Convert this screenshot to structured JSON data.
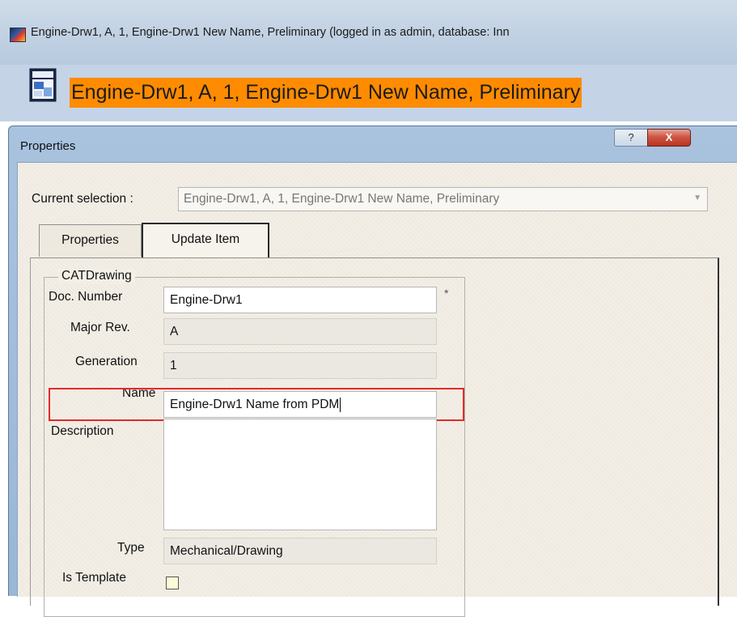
{
  "app": {
    "window_title": "Engine-Drw1, A, 1, Engine-Drw1 New Name, Preliminary (logged in as admin, database: Inn",
    "document_title": "Engine-Drw1, A, 1, Engine-Drw1 New Name, Preliminary"
  },
  "dialog": {
    "title": "Properties",
    "help_label": "?",
    "close_label": "X",
    "current_selection": {
      "label": "Current selection :",
      "value": "Engine-Drw1, A, 1, Engine-Drw1 New Name, Preliminary",
      "arrow": "▼"
    },
    "tabs": [
      {
        "label": "Properties",
        "active": false
      },
      {
        "label": "Update Item",
        "active": true
      }
    ],
    "group_title": "CATDrawing",
    "fields": {
      "doc_number": {
        "label": "Doc. Number",
        "value": "Engine-Drw1",
        "required_mark": "*"
      },
      "major_rev": {
        "label": "Major Rev.",
        "value": "A"
      },
      "generation": {
        "label": "Generation",
        "value": "1"
      },
      "name": {
        "label": "Name",
        "value": "Engine-Drw1 Name from PDM"
      },
      "description": {
        "label": "Description",
        "value": ""
      },
      "type": {
        "label": "Type",
        "value": "Mechanical/Drawing"
      },
      "is_template": {
        "label": "Is Template",
        "checked": false
      }
    }
  },
  "colors": {
    "title_highlight": "#ff8c00",
    "annotation_box": "#e32a2a",
    "dialog_frame": "#a9c3df",
    "panel_background": "#f3efe6"
  },
  "icons": [
    "catia-app-icon",
    "drawing-document-icon",
    "help-icon",
    "close-icon",
    "dropdown-arrow-icon"
  ]
}
